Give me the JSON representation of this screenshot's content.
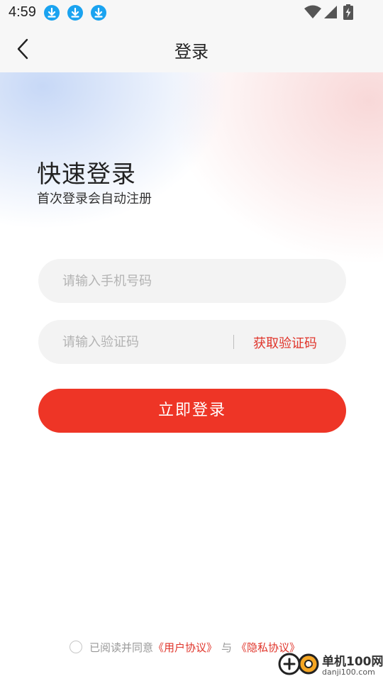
{
  "status_bar": {
    "time": "4:59",
    "icons": [
      "download-icon",
      "download-icon",
      "download-icon",
      "wifi-icon",
      "signal-icon",
      "battery-charging-icon"
    ]
  },
  "header": {
    "title": "登录",
    "back_icon": "chevron-left-icon"
  },
  "hero": {
    "title": "快速登录",
    "subtitle": "首次登录会自动注册"
  },
  "form": {
    "phone_placeholder": "请输入手机号码",
    "phone_value": "",
    "code_placeholder": "请输入验证码",
    "code_value": "",
    "get_code_label": "获取验证码",
    "login_label": "立即登录"
  },
  "agreement": {
    "prefix": "已阅读并同意",
    "user_agreement": "《用户协议》",
    "conjunction": "与",
    "privacy_policy": "《隐私协议》",
    "checked": false
  },
  "watermark": {
    "name": "单机100网",
    "url": "danji100.com"
  },
  "colors": {
    "accent": "#ee3526",
    "link": "#e0352b",
    "status_download": "#1aa3f0"
  }
}
